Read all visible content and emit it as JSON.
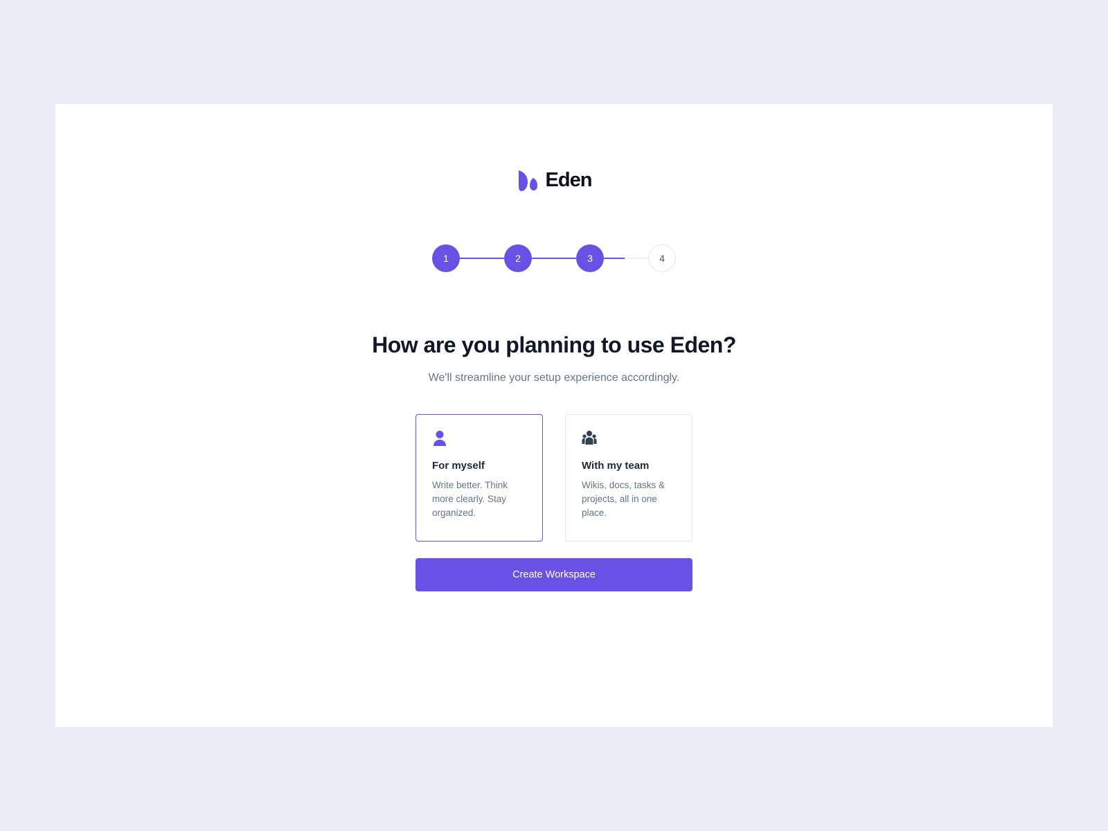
{
  "brand": {
    "name": "Eden",
    "accent_color": "#6a51e6",
    "logo_icon": "leaf-icon"
  },
  "stepper": {
    "current_step": 3,
    "total_steps": 4,
    "steps": [
      {
        "label": "1",
        "state": "complete"
      },
      {
        "label": "2",
        "state": "complete"
      },
      {
        "label": "3",
        "state": "current"
      },
      {
        "label": "4",
        "state": "upcoming"
      }
    ]
  },
  "main": {
    "title": "How are you planning to use Eden?",
    "subtitle": "We'll streamline your setup experience accordingly."
  },
  "options": [
    {
      "icon": "user-icon",
      "title": "For myself",
      "description": "Write better. Think more clearly. Stay organized.",
      "selected": true
    },
    {
      "icon": "team-icon",
      "title": "With my team",
      "description": "Wikis, docs, tasks & projects, all in one place.",
      "selected": false
    }
  ],
  "actions": {
    "primary_label": "Create Workspace"
  }
}
